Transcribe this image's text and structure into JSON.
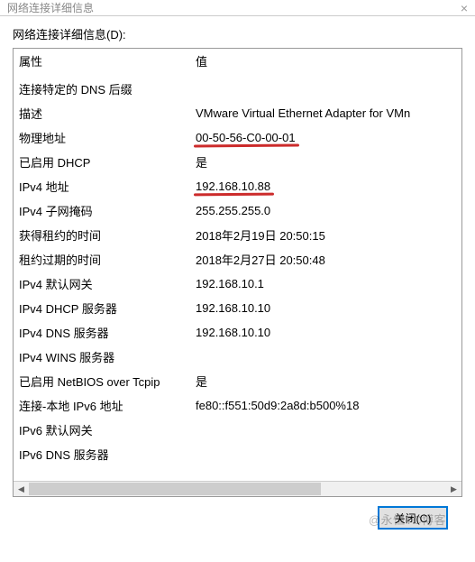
{
  "titlebar": {
    "caption": "网络连接详细信息",
    "close_glyph": "×"
  },
  "label": "网络连接详细信息(D):",
  "table": {
    "headers": {
      "property": "属性",
      "value": "值"
    },
    "rows": [
      {
        "prop": "连接特定的 DNS 后缀",
        "val": ""
      },
      {
        "prop": "描述",
        "val": "VMware Virtual Ethernet Adapter for VMn"
      },
      {
        "prop": "物理地址",
        "val": "00-50-56-C0-00-01",
        "hl": true
      },
      {
        "prop": "已启用 DHCP",
        "val": "是"
      },
      {
        "prop": "IPv4 地址",
        "val": "192.168.10.88",
        "hl": true
      },
      {
        "prop": "IPv4 子网掩码",
        "val": "255.255.255.0"
      },
      {
        "prop": "获得租约的时间",
        "val": "2018年2月19日 20:50:15"
      },
      {
        "prop": "租约过期的时间",
        "val": "2018年2月27日 20:50:48"
      },
      {
        "prop": "IPv4 默认网关",
        "val": "192.168.10.1"
      },
      {
        "prop": "IPv4 DHCP 服务器",
        "val": "192.168.10.10"
      },
      {
        "prop": "IPv4 DNS 服务器",
        "val": "192.168.10.10"
      },
      {
        "prop": "IPv4 WINS 服务器",
        "val": ""
      },
      {
        "prop": "已启用 NetBIOS over Tcpip",
        "val": "是"
      },
      {
        "prop": "连接-本地 IPv6 地址",
        "val": "fe80::f551:50d9:2a8d:b500%18"
      },
      {
        "prop": "IPv6 默认网关",
        "val": ""
      },
      {
        "prop": "IPv6 DNS 服务器",
        "val": ""
      }
    ]
  },
  "scroll": {
    "left_glyph": "◀",
    "right_glyph": "▶"
  },
  "buttons": {
    "close": "关闭(C)"
  },
  "watermark": "@永恒TC博客"
}
